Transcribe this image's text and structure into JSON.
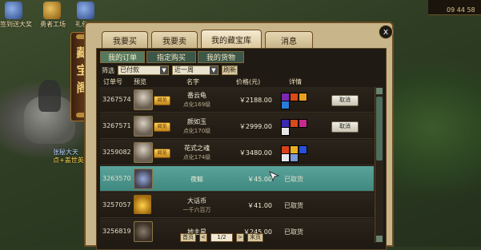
{
  "world": {
    "top_icons": [
      {
        "label": "签到送大奖",
        "icon": "gift-icon"
      },
      {
        "label": "勇者工场",
        "icon": "chest-icon"
      },
      {
        "label": "礼包",
        "icon": "gem-icon"
      }
    ],
    "minimap_time": "09 44 58",
    "npc_name_line1": "张秘大天",
    "npc_name_line2": "点+盖世英"
  },
  "window": {
    "side_title": "藏宝阁",
    "close_label": "x",
    "tabs": [
      "我要买",
      "我要卖",
      "我的藏宝库",
      "消息"
    ],
    "active_tab": 2,
    "subtabs": [
      "我的订单",
      "指定购买",
      "我的货物"
    ],
    "active_subtab": 0,
    "filter": {
      "label": "筛选",
      "status_value": "已付款",
      "period_value": "近一周",
      "button": "刷新"
    },
    "headers": [
      "订单号",
      "预览",
      "名字",
      "价格(元)",
      "详情"
    ],
    "badge_text": "阅览",
    "cancel_label": "取消",
    "rows": [
      {
        "id": "3267574",
        "name": "番云龟",
        "sub": "点化169级",
        "price": "￥2188.00",
        "status": "",
        "type": "char",
        "icons": [
          "#7a2ab0",
          "#d84a1a",
          "#e8a020",
          "#2a7ad8"
        ],
        "cancel": true,
        "badge": true,
        "selected": false
      },
      {
        "id": "3267571",
        "name": "颜如玉",
        "sub": "点化170级",
        "price": "￥2999.00",
        "status": "",
        "type": "char",
        "icons": [
          "#3a2ab0",
          "#d84a1a",
          "#c82a8a",
          "#e8e8e8"
        ],
        "cancel": true,
        "badge": true,
        "selected": false
      },
      {
        "id": "3259082",
        "name": "花式之魂",
        "sub": "点化174级",
        "price": "￥3480.00",
        "status": "",
        "type": "char",
        "icons": [
          "#d8401a",
          "#e8b020",
          "#2a50d8",
          "#e8e8f0",
          "#7a9ad8"
        ],
        "cancel": false,
        "badge": true,
        "selected": false
      },
      {
        "id": "3263570",
        "name": "夜鲸",
        "sub": "",
        "price": "￥45.00",
        "status": "已取货",
        "type": "pet",
        "icons": [],
        "cancel": false,
        "badge": false,
        "selected": true
      },
      {
        "id": "3257057",
        "name": "大话币",
        "sub": "一千六百万",
        "price": "￥41.00",
        "status": "已取货",
        "type": "coin",
        "icons": [],
        "cancel": false,
        "badge": false,
        "selected": false
      },
      {
        "id": "3256819",
        "name": "地主星",
        "sub": "",
        "price": "￥245.00",
        "status": "已取货",
        "type": "dark",
        "icons": [],
        "cancel": false,
        "badge": false,
        "selected": false
      }
    ],
    "pager": {
      "first": "首页",
      "prev": "<",
      "page": "1/2",
      "next": ">",
      "last": "末页"
    }
  }
}
